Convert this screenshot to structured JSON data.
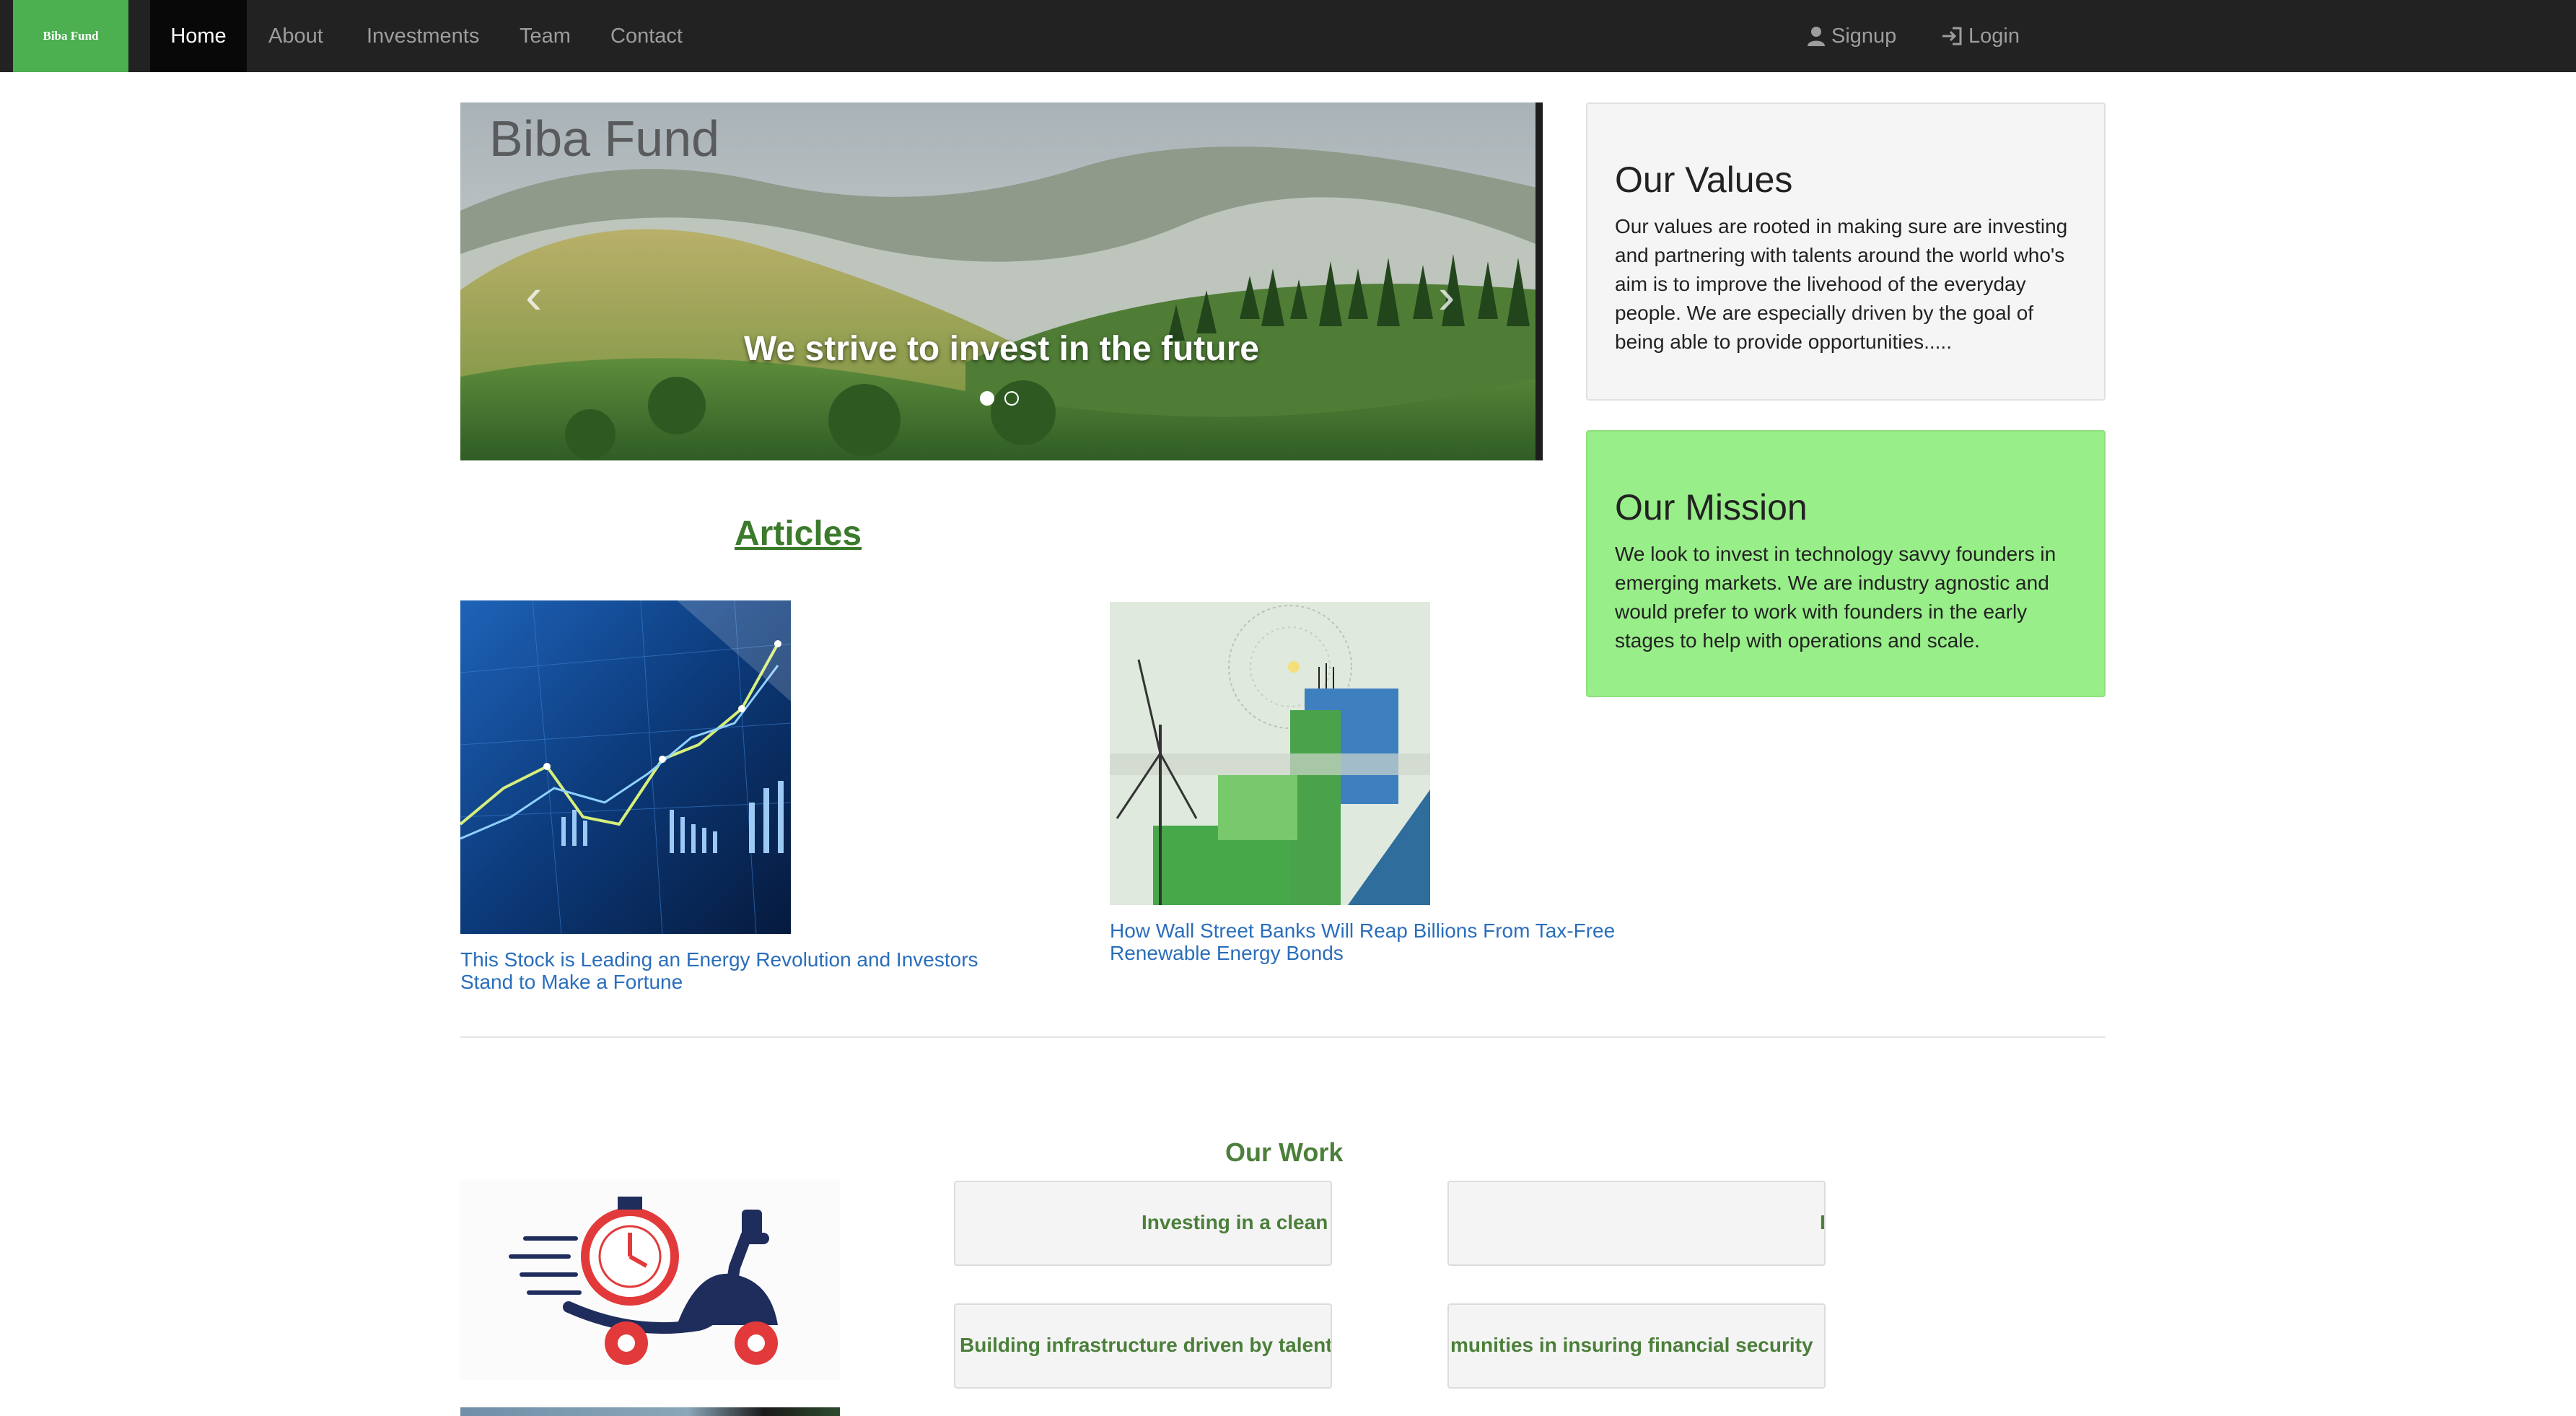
{
  "navbar": {
    "brand": "Biba Fund",
    "items": [
      "Home",
      "About",
      "Investments",
      "Team",
      "Contact"
    ],
    "active": "Home",
    "signup": "Signup",
    "login": "Login"
  },
  "carousel": {
    "brand_overlay": "Biba Fund",
    "caption": "We strive to invest in the future",
    "slides": 2,
    "active_slide": 1
  },
  "values": {
    "title": "Our Values",
    "text": "Our values are rooted in making sure are investing and partnering with talents around the world who's aim is to improve the livehood of the everyday people. We are especially driven by the goal of being able to provide opportunities....."
  },
  "mission": {
    "title": "Our Mission",
    "text": "We look to invest in technology savvy founders in emerging markets. We are industry agnostic and would prefer to work with founders in the early stages to help with operations and scale."
  },
  "articles": {
    "heading": "Articles",
    "items": [
      {
        "title": "This Stock is Leading an Energy Revolution and Investors Stand to Make a Fortune"
      },
      {
        "title": "How Wall Street Banks Will Reap Billions From Tax-Free Renewable Energy Bonds"
      }
    ]
  },
  "our_work": {
    "heading": "Our Work",
    "cards": [
      "Investing in a clean",
      "E",
      "Building infrastructure driven by talent",
      "munities in insuring financial security"
    ]
  },
  "colors": {
    "navbar_bg": "#222222",
    "brand_green": "#4caf50",
    "mission_green": "#98ee88",
    "heading_green": "#3c7a2c",
    "link_blue": "#2a6ebb"
  }
}
